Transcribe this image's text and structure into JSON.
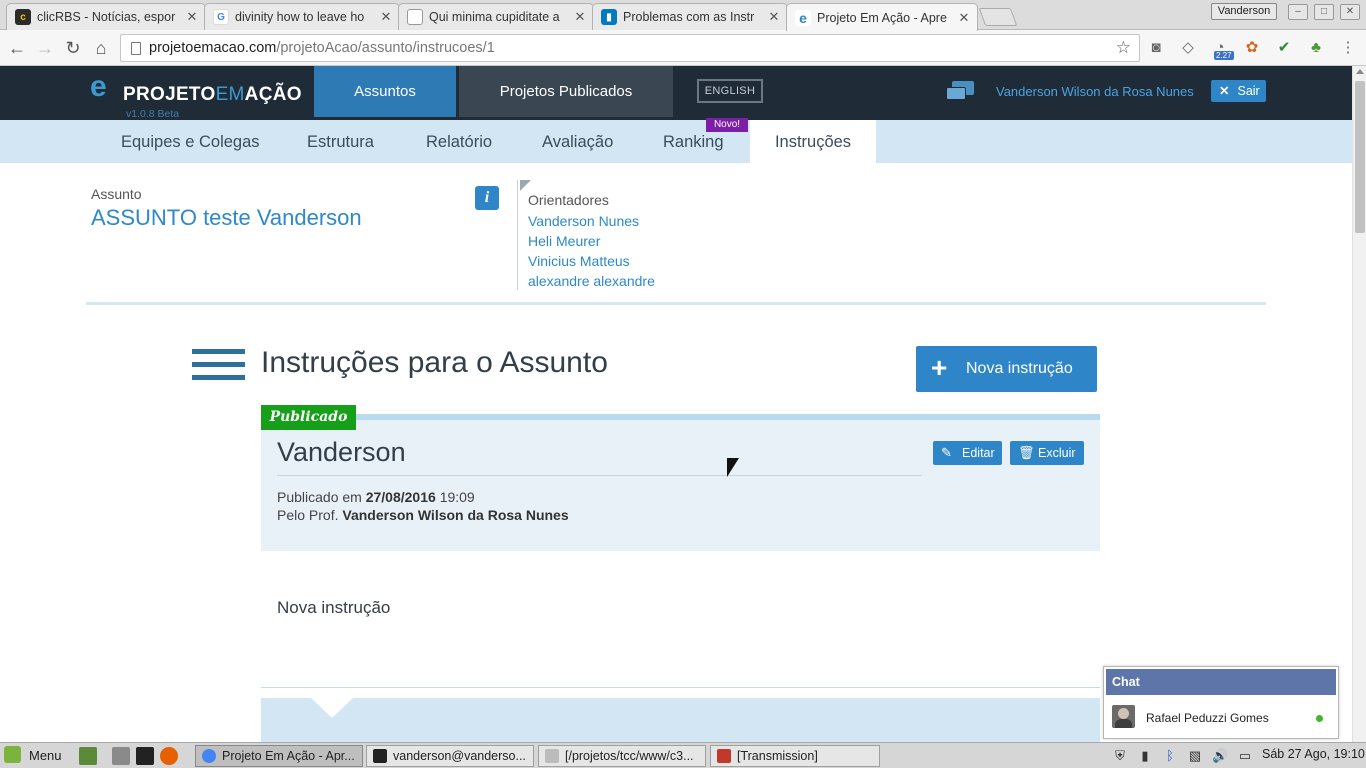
{
  "browser": {
    "tabs": [
      {
        "title": "clicRBS - Notícias, espor",
        "favicon": "clicrbs-icon"
      },
      {
        "title": "divinity how to leave ho",
        "favicon": "google-icon"
      },
      {
        "title": "Qui minima cupiditate a",
        "favicon": "page-icon"
      },
      {
        "title": "Problemas com as Instr",
        "favicon": "trello-icon"
      },
      {
        "title": "Projeto Em Ação - Apre",
        "favicon": "projetoemacao-icon",
        "active": true
      }
    ],
    "user_badge": "Vanderson",
    "url_host": "projetoemacao.com",
    "url_path": "/projetoAcao/assunto/instrucoes/1",
    "extension_badge": "2.27"
  },
  "header": {
    "logo_left": "PROJETO",
    "logo_em": "EM",
    "logo_right": "AÇÃO",
    "version": "v1.0.8 Beta",
    "nav": [
      "Assuntos",
      "Projetos Publicados"
    ],
    "lang_button": "ENGLISH",
    "user_name": "Vanderson Wilson da Rosa Nunes",
    "logout": "Sair"
  },
  "subnav": {
    "items": [
      "Equipes e Colegas",
      "Estrutura",
      "Relatório",
      "Avaliação",
      "Ranking",
      "Instruções"
    ],
    "active": "Instruções",
    "new_badge": "Novo!"
  },
  "subject": {
    "label": "Assunto",
    "title": "ASSUNTO teste Vanderson",
    "orientadores_label": "Orientadores",
    "orientadores": [
      "Vanderson Nunes",
      "Heli Meurer",
      "Vinicius Matteus",
      "alexandre alexandre"
    ]
  },
  "instructions": {
    "heading": "Instruções para o Assunto",
    "new_button": "Nova instrução",
    "card": {
      "status": "Publicado",
      "name": "Vanderson",
      "edit_label": "Editar",
      "delete_label": "Excluir",
      "published_prefix": "Publicado em",
      "published_date": "27/08/2016",
      "published_time": "19:09",
      "author_prefix": "Pelo Prof.",
      "author": "Vanderson Wilson da Rosa Nunes",
      "body": "Nova instrução"
    }
  },
  "chat": {
    "title": "Chat",
    "user": "Rafael Peduzzi Gomes",
    "status_color": "#42b72a"
  },
  "taskbar": {
    "menu": "Menu",
    "tasks": [
      {
        "title": "Projeto Em Ação - Apr...",
        "active": true
      },
      {
        "title": "vanderson@vanderso..."
      },
      {
        "title": "[/projetos/tcc/www/c3..."
      },
      {
        "title": "[Transmission]"
      }
    ],
    "clock": "Sáb 27 Ago, 19:10"
  },
  "colors": {
    "header_bg": "#1f2c38",
    "accent": "#2e86c8",
    "subnav_bg": "#d2e7f3",
    "published_green": "#16a01a",
    "new_badge_purple": "#7c1fa6"
  }
}
